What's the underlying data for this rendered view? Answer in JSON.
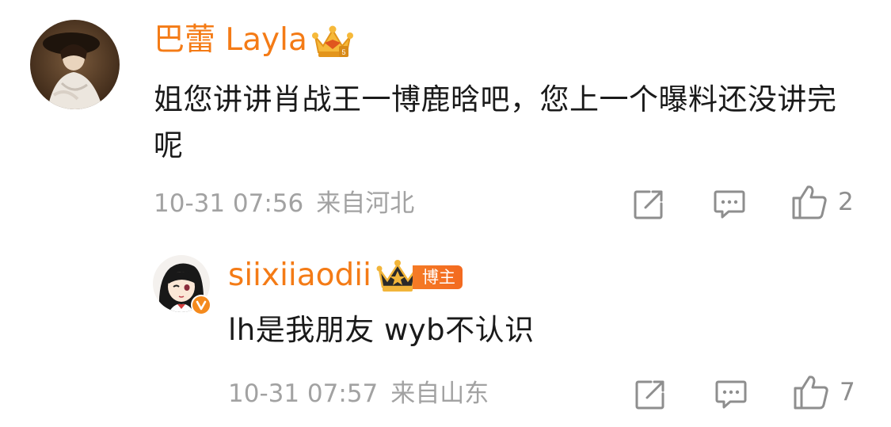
{
  "comments": [
    {
      "username": "巴蕾 Layla",
      "text": "姐您讲讲肖战王一博鹿晗吧，您上一个曝料还没讲完呢",
      "time": "10-31 07:56",
      "location": "来自河北",
      "like_count": "2"
    },
    {
      "username": "siixiiaodii",
      "role_badge": "博主",
      "text": "lh是我朋友 wyb不认识",
      "time": "10-31 07:57",
      "location": "来自山东",
      "like_count": "7"
    }
  ],
  "icons": {
    "share": "share-icon",
    "comment": "comment-icon",
    "like": "thumbs-up-icon",
    "verified": "verified-v-icon",
    "member_crown": "vip-crown-icon"
  },
  "colors": {
    "username": "#f47b16",
    "text": "#1a1a1a",
    "meta": "#a2a2a2",
    "icon": "#8e8e8e",
    "badge": "#f36a20"
  }
}
